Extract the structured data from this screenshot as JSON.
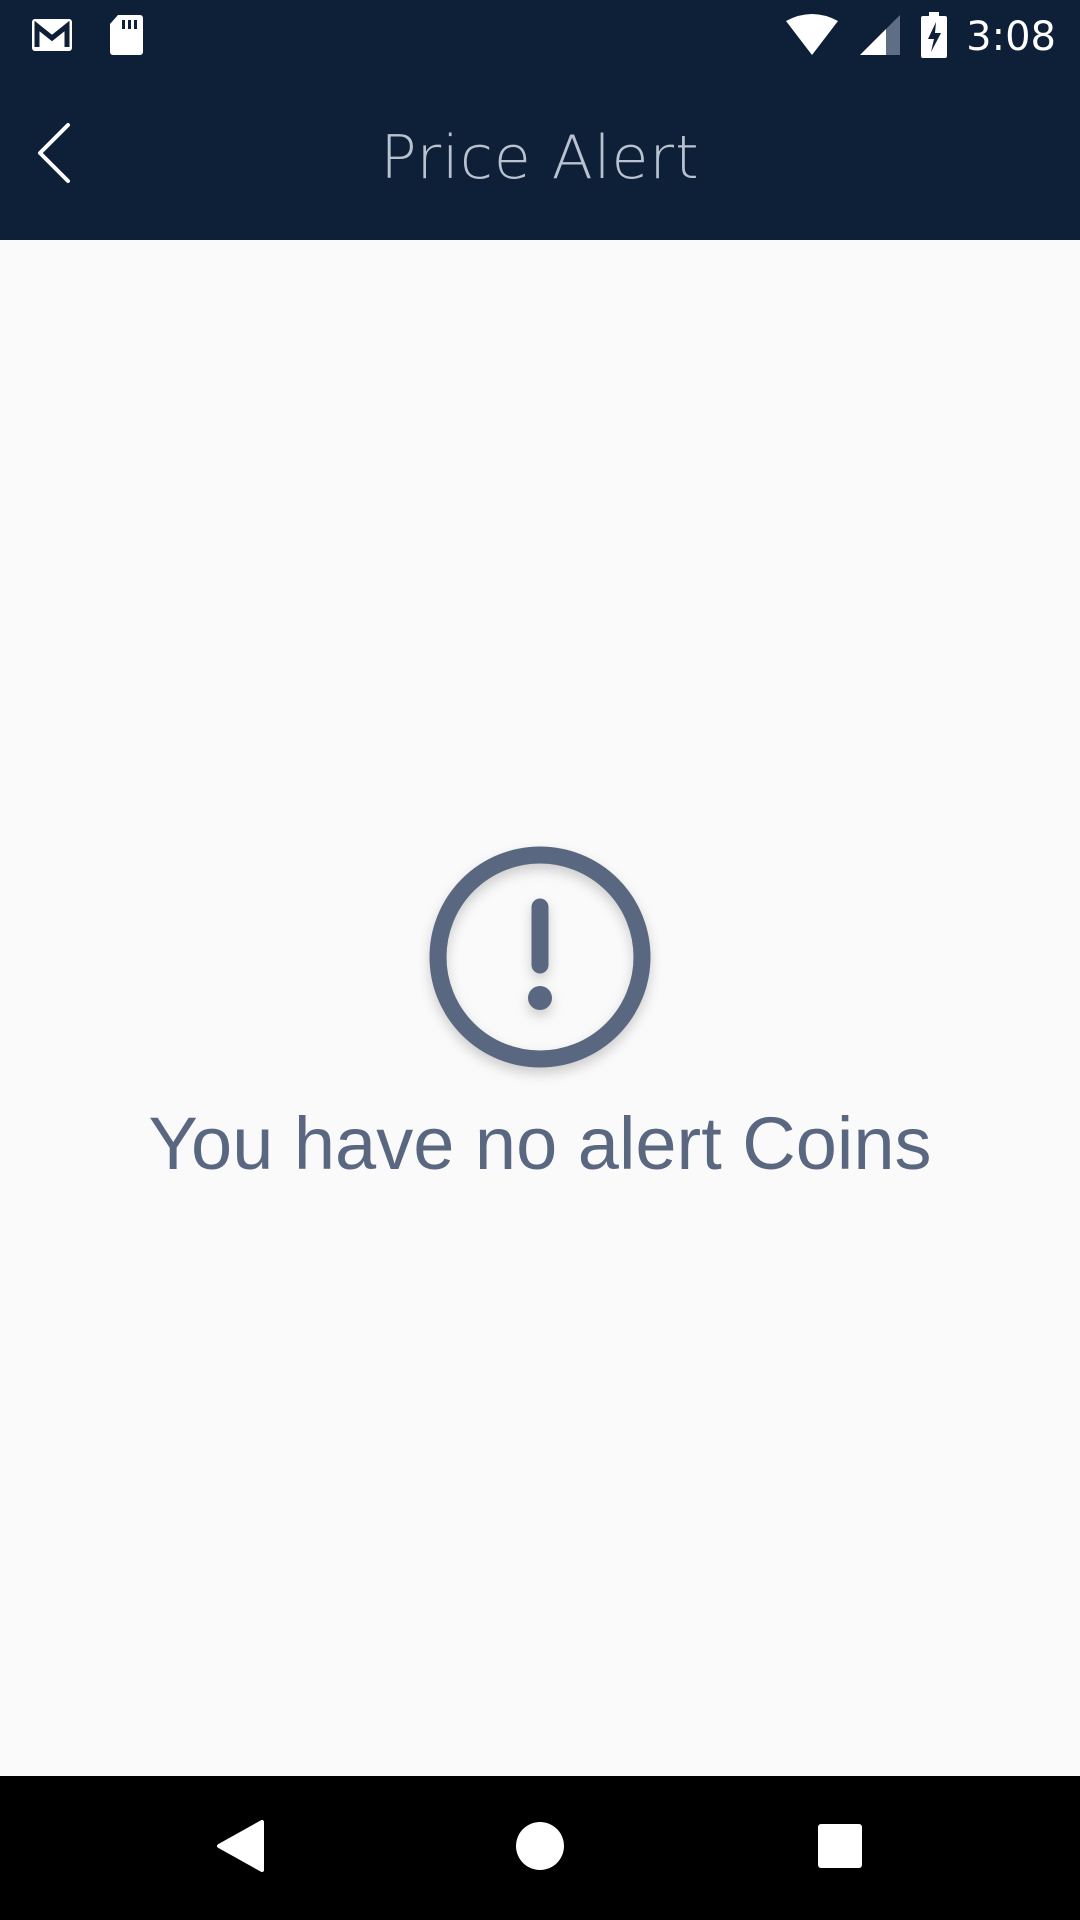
{
  "status_bar": {
    "time": "3:08",
    "icons": [
      "gmail-icon",
      "sd-card-icon",
      "wifi-icon",
      "cell-signal-icon",
      "battery-charging-icon"
    ]
  },
  "app_bar": {
    "title": "Price Alert",
    "back_icon": "chevron-left-icon"
  },
  "empty_state": {
    "icon": "alert-circle-icon",
    "message": "You have no alert Coins"
  },
  "nav_bar": {
    "icons": [
      "back-triangle-icon",
      "home-circle-icon",
      "recents-square-icon"
    ]
  },
  "colors": {
    "header_bg": "#0e1f38",
    "title_text": "#b9c2cf",
    "page_bg": "#fafafa",
    "empty_text": "#5a6780",
    "icon": "#5a6780"
  }
}
